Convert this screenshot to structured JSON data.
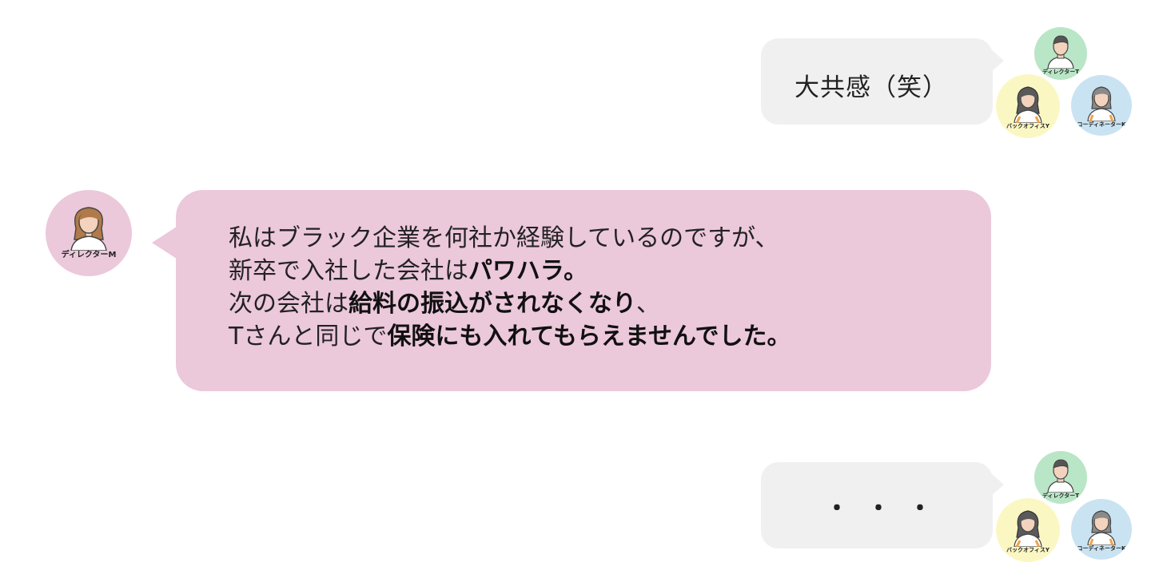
{
  "messages": [
    {
      "side": "right",
      "text": "大共感（笑）"
    },
    {
      "side": "left",
      "lines": [
        [
          {
            "t": "私はブラック企業を何社か経験しているのですが、",
            "b": false
          }
        ],
        [
          {
            "t": "新卒で入社した会社は",
            "b": false
          },
          {
            "t": "パワハラ。",
            "b": true
          }
        ],
        [
          {
            "t": "次の会社は",
            "b": false
          },
          {
            "t": "給料の振込がされなくなり",
            "b": true
          },
          {
            "t": "、",
            "b": false
          }
        ],
        [
          {
            "t": "Tさんと同じで",
            "b": false
          },
          {
            "t": "保険にも入れてもらえませんでした。",
            "b": true
          }
        ]
      ]
    },
    {
      "side": "right",
      "text": "・・・"
    }
  ],
  "avatars": {
    "director_t": {
      "label": "ディレクターT",
      "bg": "#b9e6c6"
    },
    "backoffice_y": {
      "label": "バックオフィスY",
      "bg": "#fbf7c3"
    },
    "coordinator_k": {
      "label": "コーディネーターK",
      "bg": "#c9e3f2"
    },
    "director_m": {
      "label": "ディレクターM",
      "bg": "#ecc8db"
    }
  },
  "colors": {
    "pink_bubble": "#ecc8db",
    "gray_bubble": "#f0f0f0"
  }
}
